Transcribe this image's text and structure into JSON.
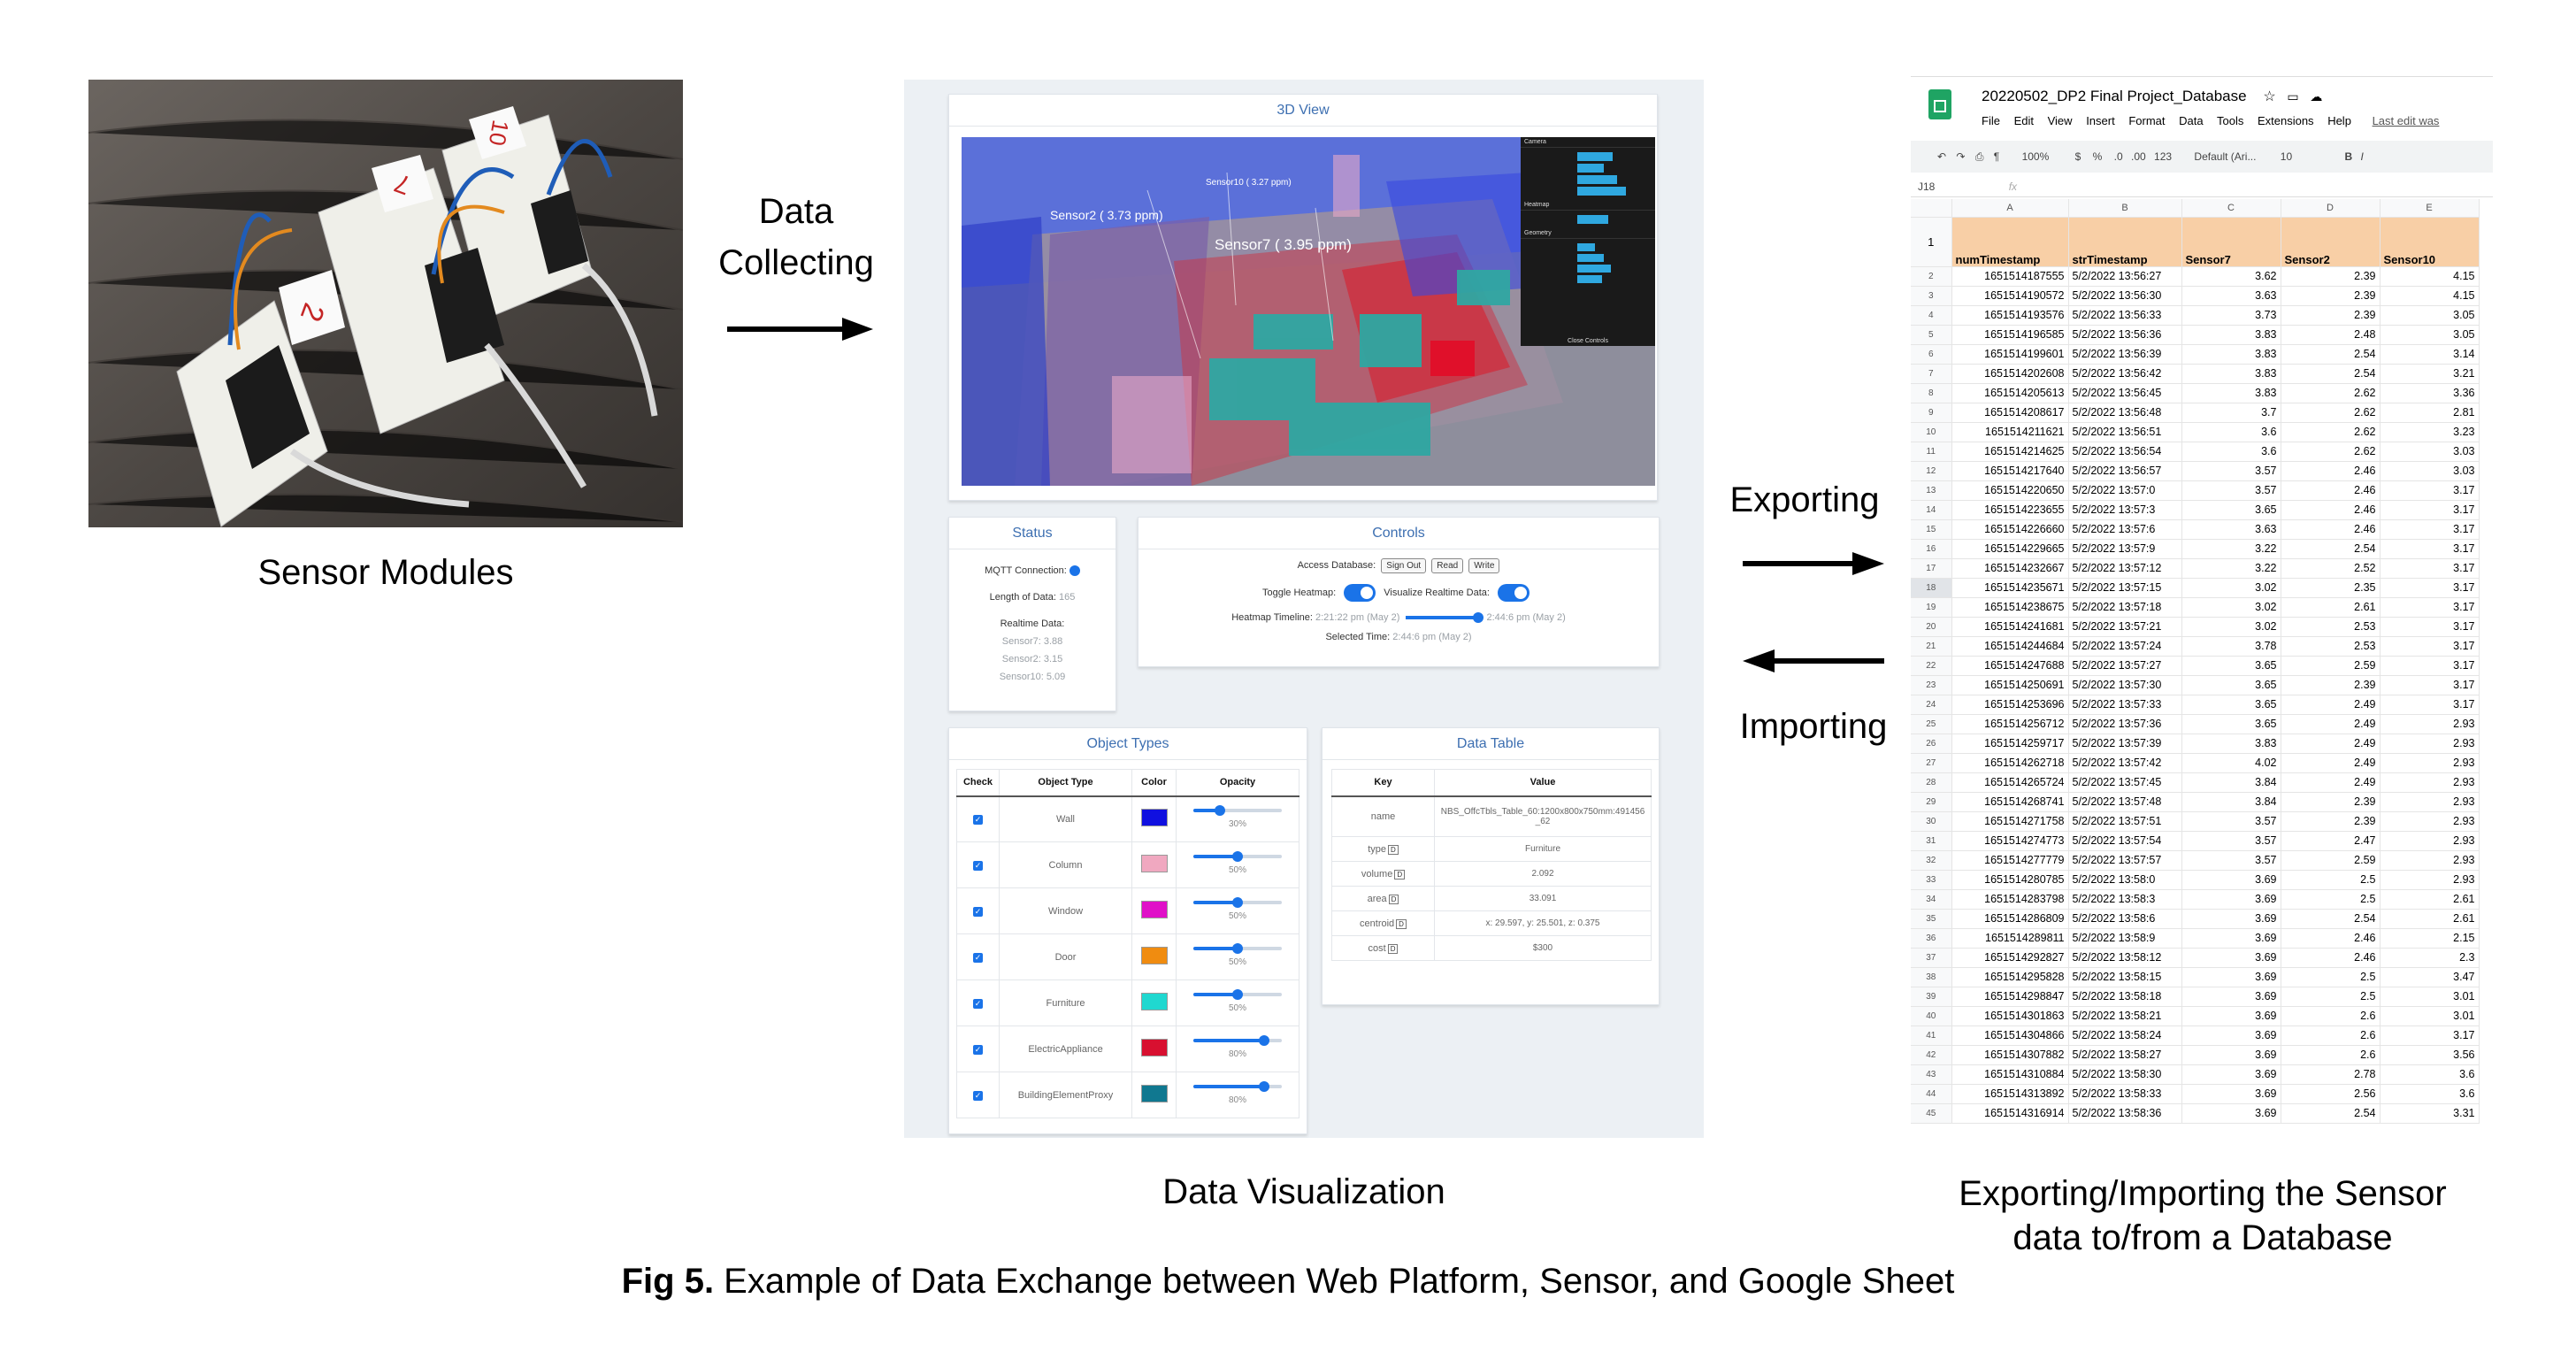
{
  "photo": {
    "note_labels": [
      "2",
      "7",
      "10"
    ]
  },
  "captions": {
    "sensor_modules": "Sensor Modules",
    "data_visualization": "Data Visualization",
    "exporting_importing_line1": "Exporting/Importing the Sensor",
    "exporting_importing_line2": "data to/from a Database"
  },
  "arrows": {
    "collecting_line1": "Data",
    "collecting_line2": "Collecting",
    "exporting": "Exporting",
    "importing": "Importing"
  },
  "figure_caption": {
    "label": "Fig 5.",
    "text": " Example of Data Exchange between Web Platform, Sensor, and Google Sheet"
  },
  "webapp": {
    "view3d": {
      "title": "3D View",
      "sensor_labels": [
        "Sensor2 ( 3.73 ppm)",
        "Sensor7 ( 3.95 ppm)",
        "Sensor10 ( 3.27 ppm)"
      ],
      "gui_sections": [
        "Camera",
        "Heatmap",
        "Geometry"
      ],
      "gui_close": "Close Controls"
    },
    "status": {
      "title": "Status",
      "mqtt_label": "MQTT Connection:",
      "length_label": "Length of Data:",
      "length_value": "165",
      "realtime_label": "Realtime Data:",
      "realtime_values": [
        "Sensor7: 3.88",
        "Sensor2: 3.15",
        "Sensor10: 5.09"
      ]
    },
    "controls": {
      "title": "Controls",
      "access_label": "Access Database:",
      "buttons": [
        "Sign Out",
        "Read",
        "Write"
      ],
      "toggle_heatmap": "Toggle Heatmap:",
      "visualize_realtime": "Visualize Realtime Data:",
      "timeline_label": "Heatmap Timeline:",
      "timeline_start": "2:21:22 pm (May 2)",
      "timeline_end": "2:44:6 pm (May 2)",
      "selected_label": "Selected Time:",
      "selected_value": "2:44:6 pm (May 2)"
    },
    "object_types": {
      "title": "Object Types",
      "headers": [
        "Check",
        "Object Type",
        "Color",
        "Opacity"
      ],
      "rows": [
        {
          "name": "Wall",
          "color": "#1010e0",
          "opacity": "30%",
          "level": 0.3
        },
        {
          "name": "Column",
          "color": "#f0a8c0",
          "opacity": "50%",
          "level": 0.5
        },
        {
          "name": "Window",
          "color": "#e010c8",
          "opacity": "50%",
          "level": 0.5
        },
        {
          "name": "Door",
          "color": "#f08c10",
          "opacity": "50%",
          "level": 0.5
        },
        {
          "name": "Furniture",
          "color": "#20d8d0",
          "opacity": "50%",
          "level": 0.5
        },
        {
          "name": "ElectricAppliance",
          "color": "#d81030",
          "opacity": "80%",
          "level": 0.8
        },
        {
          "name": "BuildingElementProxy",
          "color": "#107890",
          "opacity": "80%",
          "level": 0.8
        }
      ]
    },
    "data_table": {
      "title": "Data Table",
      "headers": [
        "Key",
        "Value"
      ],
      "rows": [
        {
          "key": "name",
          "value": "NBS_OffcTbls_Table_60:1200x800x750mm:491456_62"
        },
        {
          "key": "type",
          "value": "Furniture"
        },
        {
          "key": "volume",
          "value": "2.092"
        },
        {
          "key": "area",
          "value": "33.091"
        },
        {
          "key": "centroid",
          "value": "x: 29.597, y: 25.501, z: 0.375"
        },
        {
          "key": "cost",
          "value": "$300"
        }
      ]
    }
  },
  "sheet": {
    "title": "20220502_DP2 Final Project_Database",
    "menu": [
      "File",
      "Edit",
      "View",
      "Insert",
      "Format",
      "Data",
      "Tools",
      "Extensions",
      "Help"
    ],
    "last_edit": "Last edit was",
    "toolbar": {
      "zoom": "100%",
      "currency": "$",
      "percent": "%",
      "dec0": ".0",
      "dec00": ".00",
      "fmt": "123",
      "font": "Default (Ari...",
      "size": "10",
      "bold": "B",
      "italic": "I"
    },
    "cell_ref": "J18",
    "fx": "fx",
    "columns": [
      "A",
      "B",
      "C",
      "D",
      "E"
    ],
    "headers": [
      "numTimestamp",
      "strTimestamp",
      "Sensor7",
      "Sensor2",
      "Sensor10"
    ],
    "rows": [
      [
        "1651514187555",
        "5/2/2022 13:56:27",
        "3.62",
        "2.39",
        "4.15"
      ],
      [
        "1651514190572",
        "5/2/2022 13:56:30",
        "3.63",
        "2.39",
        "4.15"
      ],
      [
        "1651514193576",
        "5/2/2022 13:56:33",
        "3.73",
        "2.39",
        "3.05"
      ],
      [
        "1651514196585",
        "5/2/2022 13:56:36",
        "3.83",
        "2.48",
        "3.05"
      ],
      [
        "1651514199601",
        "5/2/2022 13:56:39",
        "3.83",
        "2.54",
        "3.14"
      ],
      [
        "1651514202608",
        "5/2/2022 13:56:42",
        "3.83",
        "2.54",
        "3.21"
      ],
      [
        "1651514205613",
        "5/2/2022 13:56:45",
        "3.83",
        "2.62",
        "3.36"
      ],
      [
        "1651514208617",
        "5/2/2022 13:56:48",
        "3.7",
        "2.62",
        "2.81"
      ],
      [
        "1651514211621",
        "5/2/2022 13:56:51",
        "3.6",
        "2.62",
        "3.23"
      ],
      [
        "1651514214625",
        "5/2/2022 13:56:54",
        "3.6",
        "2.62",
        "3.03"
      ],
      [
        "1651514217640",
        "5/2/2022 13:56:57",
        "3.57",
        "2.46",
        "3.03"
      ],
      [
        "1651514220650",
        "5/2/2022 13:57:0",
        "3.57",
        "2.46",
        "3.17"
      ],
      [
        "1651514223655",
        "5/2/2022 13:57:3",
        "3.65",
        "2.46",
        "3.17"
      ],
      [
        "1651514226660",
        "5/2/2022 13:57:6",
        "3.63",
        "2.46",
        "3.17"
      ],
      [
        "1651514229665",
        "5/2/2022 13:57:9",
        "3.22",
        "2.54",
        "3.17"
      ],
      [
        "1651514232667",
        "5/2/2022 13:57:12",
        "3.22",
        "2.52",
        "3.17"
      ],
      [
        "1651514235671",
        "5/2/2022 13:57:15",
        "3.02",
        "2.35",
        "3.17"
      ],
      [
        "1651514238675",
        "5/2/2022 13:57:18",
        "3.02",
        "2.61",
        "3.17"
      ],
      [
        "1651514241681",
        "5/2/2022 13:57:21",
        "3.02",
        "2.53",
        "3.17"
      ],
      [
        "1651514244684",
        "5/2/2022 13:57:24",
        "3.78",
        "2.53",
        "3.17"
      ],
      [
        "1651514247688",
        "5/2/2022 13:57:27",
        "3.65",
        "2.59",
        "3.17"
      ],
      [
        "1651514250691",
        "5/2/2022 13:57:30",
        "3.65",
        "2.39",
        "3.17"
      ],
      [
        "1651514253696",
        "5/2/2022 13:57:33",
        "3.65",
        "2.49",
        "3.17"
      ],
      [
        "1651514256712",
        "5/2/2022 13:57:36",
        "3.65",
        "2.49",
        "2.93"
      ],
      [
        "1651514259717",
        "5/2/2022 13:57:39",
        "3.83",
        "2.49",
        "2.93"
      ],
      [
        "1651514262718",
        "5/2/2022 13:57:42",
        "4.02",
        "2.49",
        "2.93"
      ],
      [
        "1651514265724",
        "5/2/2022 13:57:45",
        "3.84",
        "2.49",
        "2.93"
      ],
      [
        "1651514268741",
        "5/2/2022 13:57:48",
        "3.84",
        "2.39",
        "2.93"
      ],
      [
        "1651514271758",
        "5/2/2022 13:57:51",
        "3.57",
        "2.39",
        "2.93"
      ],
      [
        "1651514274773",
        "5/2/2022 13:57:54",
        "3.57",
        "2.47",
        "2.93"
      ],
      [
        "1651514277779",
        "5/2/2022 13:57:57",
        "3.57",
        "2.59",
        "2.93"
      ],
      [
        "1651514280785",
        "5/2/2022 13:58:0",
        "3.69",
        "2.5",
        "2.93"
      ],
      [
        "1651514283798",
        "5/2/2022 13:58:3",
        "3.69",
        "2.5",
        "2.61"
      ],
      [
        "1651514286809",
        "5/2/2022 13:58:6",
        "3.69",
        "2.54",
        "2.61"
      ],
      [
        "1651514289811",
        "5/2/2022 13:58:9",
        "3.69",
        "2.46",
        "2.15"
      ],
      [
        "1651514292827",
        "5/2/2022 13:58:12",
        "3.69",
        "2.46",
        "2.3"
      ],
      [
        "1651514295828",
        "5/2/2022 13:58:15",
        "3.69",
        "2.5",
        "3.47"
      ],
      [
        "1651514298847",
        "5/2/2022 13:58:18",
        "3.69",
        "2.5",
        "3.01"
      ],
      [
        "1651514301863",
        "5/2/2022 13:58:21",
        "3.69",
        "2.6",
        "3.01"
      ],
      [
        "1651514304866",
        "5/2/2022 13:58:24",
        "3.69",
        "2.6",
        "3.17"
      ],
      [
        "1651514307882",
        "5/2/2022 13:58:27",
        "3.69",
        "2.6",
        "3.56"
      ],
      [
        "1651514310884",
        "5/2/2022 13:58:30",
        "3.69",
        "2.78",
        "3.6"
      ],
      [
        "1651514313892",
        "5/2/2022 13:58:33",
        "3.69",
        "2.56",
        "3.6"
      ],
      [
        "1651514316914",
        "5/2/2022 13:58:36",
        "3.69",
        "2.54",
        "3.31"
      ]
    ]
  }
}
